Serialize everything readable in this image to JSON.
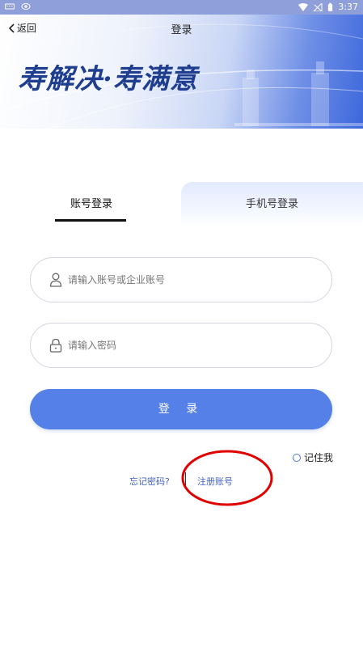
{
  "status_bar": {
    "time": "3:37",
    "icons": [
      "keyboard-icon",
      "eye-icon",
      "wifi-icon",
      "signal-icon",
      "battery-icon"
    ]
  },
  "header": {
    "back_label": "返回",
    "title": "登录",
    "slogan": "寿解决·寿满意"
  },
  "tabs": [
    {
      "label": "账号登录",
      "active": true
    },
    {
      "label": "手机号登录",
      "active": false
    }
  ],
  "form": {
    "account_placeholder": "请输入账号或企业账号",
    "account_value": "",
    "password_placeholder": "请输入密码",
    "password_value": "",
    "login_label": "登 录",
    "remember_label": "记住我"
  },
  "links": {
    "forgot": "忘记密码?",
    "register": "注册账号"
  },
  "colors": {
    "accent": "#5580e8",
    "link": "#4463c9",
    "annotation": "#e00000"
  }
}
